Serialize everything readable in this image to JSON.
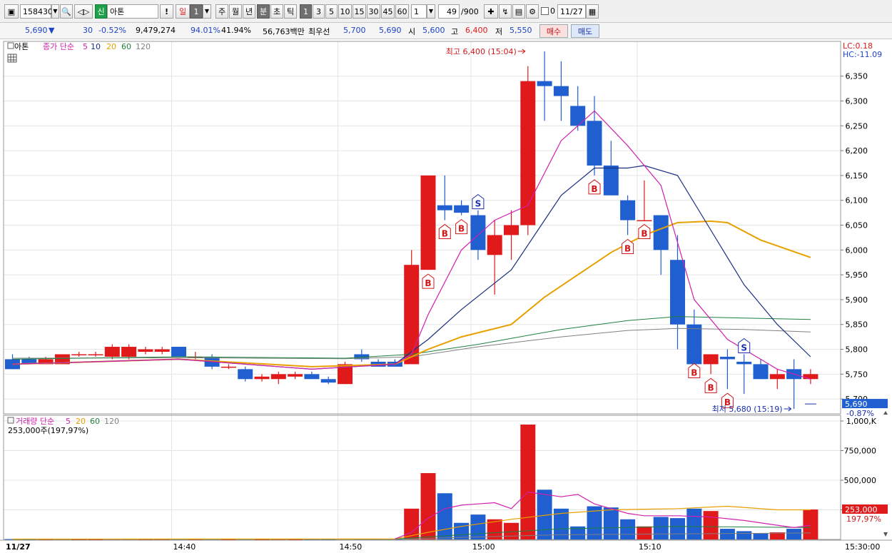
{
  "toolbar": {
    "code": "158430",
    "credit_tag": "신",
    "name": "아톤",
    "alert": "!",
    "day_label": "일",
    "day_count": "1",
    "periods": [
      "주",
      "월",
      "년",
      "분",
      "초",
      "틱"
    ],
    "selected_period": "분",
    "intervals": [
      "1",
      "3",
      "5",
      "10",
      "15",
      "30",
      "45",
      "60"
    ],
    "selected_interval": "1",
    "custom_interval": "1",
    "bar_count": "49",
    "bar_total": "/900",
    "checkbox_label": "0",
    "date": "11/27"
  },
  "quote": {
    "price": "5,690",
    "direction": "▼",
    "change": "30",
    "change_pct": "-0.52%",
    "volume": "9,479,274",
    "ratio1": "94.01%",
    "ratio2": "41.94%",
    "amount": "56,763백만",
    "best_ask_label": "최우선",
    "best_ask": "5,700",
    "best_bid": "5,690",
    "open_label": "시",
    "open": "5,600",
    "high_label": "고",
    "high": "6,400",
    "low_label": "저",
    "low": "5,550",
    "buy_label": "매수",
    "sell_label": "매도"
  },
  "colors": {
    "up": "#e0191b",
    "down": "#1f5fcf",
    "ma5": "#d020b0",
    "ma10": "#1a2f80",
    "ma20": "#e8a000",
    "ma60": "#208040",
    "ma120": "#808080"
  },
  "chart_data": {
    "type": "candlestick",
    "price_panel": {
      "name_tag": "아톤",
      "legend_label": "종가 단순",
      "ma_periods": [
        "5",
        "10",
        "20",
        "60",
        "120"
      ],
      "lc_text": "LC:0.18",
      "hc_text": "HC:-11.09",
      "y_ticks": [
        "6,350",
        "6,300",
        "6,250",
        "6,200",
        "6,150",
        "6,100",
        "6,050",
        "6,000",
        "5,950",
        "5,900",
        "5,850",
        "5,800",
        "5,750",
        "5,700"
      ],
      "ylim": [
        5670,
        6420
      ],
      "current_price": "5,690",
      "current_pct": "-0.87%",
      "high_note": "최고 6,400 (15:04)",
      "low_note": "최저 5,680 (15:19)"
    },
    "volume_panel": {
      "legend_label": "거래량 단순",
      "ma_periods": [
        "5",
        "20",
        "60",
        "120"
      ],
      "current_text": "253,000주(197,97%)",
      "y_ticks": [
        "1,000,K",
        "750,000",
        "500,000",
        "250,000"
      ],
      "ylim": [
        0,
        1000000
      ],
      "current_value": "253,000",
      "current_pct": "197,97%"
    },
    "x_labels": [
      {
        "text": "11/27",
        "i": 0
      },
      {
        "text": "14:40",
        "i": 10
      },
      {
        "text": "14:50",
        "i": 20
      },
      {
        "text": "15:00",
        "i": 28
      },
      {
        "text": "15:10",
        "i": 38
      },
      {
        "text": "15:30:00",
        "i": 48
      }
    ],
    "candles": [
      {
        "t": "14:30",
        "o": 5780,
        "h": 5790,
        "l": 5760,
        "c": 5760,
        "v": 3000
      },
      {
        "t": "14:31",
        "o": 5780,
        "h": 5785,
        "l": 5770,
        "c": 5770,
        "v": 2000
      },
      {
        "t": "14:32",
        "o": 5770,
        "h": 5785,
        "l": 5770,
        "c": 5780,
        "v": 2000
      },
      {
        "t": "14:33",
        "o": 5770,
        "h": 5790,
        "l": 5770,
        "c": 5790,
        "v": 3000
      },
      {
        "t": "14:34",
        "o": 5790,
        "h": 5795,
        "l": 5785,
        "c": 5790,
        "v": 1000
      },
      {
        "t": "14:35",
        "o": 5790,
        "h": 5795,
        "l": 5785,
        "c": 5790,
        "v": 1000
      },
      {
        "t": "14:36",
        "o": 5785,
        "h": 5810,
        "l": 5780,
        "c": 5805,
        "v": 4000
      },
      {
        "t": "14:37",
        "o": 5785,
        "h": 5810,
        "l": 5780,
        "c": 5805,
        "v": 4000
      },
      {
        "t": "14:38",
        "o": 5795,
        "h": 5805,
        "l": 5790,
        "c": 5800,
        "v": 2000
      },
      {
        "t": "14:39",
        "o": 5795,
        "h": 5805,
        "l": 5790,
        "c": 5800,
        "v": 2000
      },
      {
        "t": "14:40",
        "o": 5805,
        "h": 5805,
        "l": 5785,
        "c": 5785,
        "v": 3000
      },
      {
        "t": "14:41",
        "o": 5785,
        "h": 5795,
        "l": 5780,
        "c": 5785,
        "v": 2000
      },
      {
        "t": "14:42",
        "o": 5785,
        "h": 5790,
        "l": 5760,
        "c": 5765,
        "v": 3000
      },
      {
        "t": "14:43",
        "o": 5765,
        "h": 5770,
        "l": 5760,
        "c": 5765,
        "v": 1000
      },
      {
        "t": "14:44",
        "o": 5760,
        "h": 5765,
        "l": 5735,
        "c": 5740,
        "v": 3000
      },
      {
        "t": "14:45",
        "o": 5740,
        "h": 5750,
        "l": 5735,
        "c": 5745,
        "v": 1000
      },
      {
        "t": "14:46",
        "o": 5740,
        "h": 5755,
        "l": 5730,
        "c": 5750,
        "v": 2000
      },
      {
        "t": "14:47",
        "o": 5745,
        "h": 5755,
        "l": 5740,
        "c": 5750,
        "v": 1000
      },
      {
        "t": "14:48",
        "o": 5750,
        "h": 5755,
        "l": 5740,
        "c": 5740,
        "v": 2000
      },
      {
        "t": "14:49",
        "o": 5740,
        "h": 5745,
        "l": 5730,
        "c": 5733,
        "v": 2000
      },
      {
        "t": "14:50",
        "o": 5730,
        "h": 5775,
        "l": 5730,
        "c": 5770,
        "v": 6000
      },
      {
        "t": "14:51",
        "o": 5790,
        "h": 5800,
        "l": 5775,
        "c": 5780,
        "v": 5000
      },
      {
        "t": "14:52",
        "o": 5775,
        "h": 5780,
        "l": 5765,
        "c": 5765,
        "v": 4000
      },
      {
        "t": "14:53",
        "o": 5775,
        "h": 5780,
        "l": 5765,
        "c": 5765,
        "v": 4000
      },
      {
        "t": "14:54",
        "o": 5770,
        "h": 6000,
        "l": 5770,
        "c": 5970,
        "v": 260000
      },
      {
        "t": "14:55",
        "o": 5960,
        "h": 6150,
        "l": 5960,
        "c": 6150,
        "v": 560000
      },
      {
        "t": "14:56",
        "o": 6090,
        "h": 6150,
        "l": 6060,
        "c": 6080,
        "v": 390000
      },
      {
        "t": "14:57",
        "o": 6090,
        "h": 6100,
        "l": 6070,
        "c": 6075,
        "v": 140000
      },
      {
        "t": "14:58",
        "o": 6070,
        "h": 6080,
        "l": 5980,
        "c": 6000,
        "v": 210000
      },
      {
        "t": "14:59",
        "o": 5990,
        "h": 6060,
        "l": 5910,
        "c": 6030,
        "v": 170000
      },
      {
        "t": "15:00",
        "o": 6030,
        "h": 6080,
        "l": 5980,
        "c": 6050,
        "v": 140000
      },
      {
        "t": "15:01",
        "o": 6050,
        "h": 6370,
        "l": 6030,
        "c": 6340,
        "v": 970000
      },
      {
        "t": "15:02",
        "o": 6340,
        "h": 6400,
        "l": 6260,
        "c": 6330,
        "v": 420000
      },
      {
        "t": "15:03",
        "o": 6330,
        "h": 6380,
        "l": 6260,
        "c": 6310,
        "v": 260000
      },
      {
        "t": "15:04",
        "o": 6290,
        "h": 6330,
        "l": 6240,
        "c": 6250,
        "v": 110000
      },
      {
        "t": "15:05",
        "o": 6260,
        "h": 6310,
        "l": 6150,
        "c": 6170,
        "v": 280000
      },
      {
        "t": "15:06",
        "o": 6170,
        "h": 6220,
        "l": 6110,
        "c": 6110,
        "v": 270000
      },
      {
        "t": "15:07",
        "o": 6100,
        "h": 6110,
        "l": 6030,
        "c": 6060,
        "v": 170000
      },
      {
        "t": "15:08",
        "o": 6060,
        "h": 6140,
        "l": 6060,
        "c": 6060,
        "v": 110000
      },
      {
        "t": "15:09",
        "o": 6070,
        "h": 6070,
        "l": 5950,
        "c": 6000,
        "v": 190000
      },
      {
        "t": "15:10",
        "o": 5980,
        "h": 6030,
        "l": 5800,
        "c": 5850,
        "v": 180000
      },
      {
        "t": "15:11",
        "o": 5850,
        "h": 5880,
        "l": 5780,
        "c": 5770,
        "v": 260000
      },
      {
        "t": "15:12",
        "o": 5770,
        "h": 5790,
        "l": 5750,
        "c": 5790,
        "v": 240000
      },
      {
        "t": "15:13",
        "o": 5785,
        "h": 5800,
        "l": 5720,
        "c": 5780,
        "v": 90000
      },
      {
        "t": "15:14",
        "o": 5775,
        "h": 5790,
        "l": 5710,
        "c": 5770,
        "v": 70000
      },
      {
        "t": "15:15",
        "o": 5770,
        "h": 5780,
        "l": 5740,
        "c": 5740,
        "v": 50000
      },
      {
        "t": "15:16",
        "o": 5740,
        "h": 5760,
        "l": 5720,
        "c": 5750,
        "v": 60000
      },
      {
        "t": "15:17",
        "o": 5760,
        "h": 5780,
        "l": 5680,
        "c": 5740,
        "v": 90000
      },
      {
        "t": "15:18",
        "o": 5740,
        "h": 5760,
        "l": 5730,
        "c": 5750,
        "v": 253000
      }
    ],
    "ma_lines": {
      "ma5": [
        [
          0,
          5770
        ],
        [
          10,
          5780
        ],
        [
          18,
          5760
        ],
        [
          23,
          5770
        ],
        [
          24,
          5790
        ],
        [
          25,
          5870
        ],
        [
          27,
          6000
        ],
        [
          29,
          6060
        ],
        [
          31,
          6090
        ],
        [
          33,
          6220
        ],
        [
          35,
          6280
        ],
        [
          37,
          6210
        ],
        [
          39,
          6130
        ],
        [
          41,
          5900
        ],
        [
          43,
          5820
        ],
        [
          46,
          5760
        ],
        [
          48,
          5740
        ]
      ],
      "ma10": [
        [
          0,
          5770
        ],
        [
          10,
          5780
        ],
        [
          18,
          5760
        ],
        [
          23,
          5770
        ],
        [
          25,
          5820
        ],
        [
          27,
          5880
        ],
        [
          30,
          5960
        ],
        [
          33,
          6110
        ],
        [
          35,
          6165
        ],
        [
          37,
          6165
        ],
        [
          38,
          6170
        ],
        [
          40,
          6150
        ],
        [
          42,
          6040
        ],
        [
          44,
          5930
        ],
        [
          46,
          5850
        ],
        [
          48,
          5785
        ]
      ],
      "ma20": [
        [
          0,
          5770
        ],
        [
          10,
          5780
        ],
        [
          18,
          5765
        ],
        [
          23,
          5770
        ],
        [
          25,
          5800
        ],
        [
          27,
          5825
        ],
        [
          30,
          5850
        ],
        [
          32,
          5905
        ],
        [
          34,
          5950
        ],
        [
          36,
          5995
        ],
        [
          38,
          6030
        ],
        [
          40,
          6055
        ],
        [
          42,
          6058
        ],
        [
          43,
          6055
        ],
        [
          45,
          6020
        ],
        [
          48,
          5985
        ]
      ],
      "ma60": [
        [
          0,
          5780
        ],
        [
          10,
          5785
        ],
        [
          20,
          5782
        ],
        [
          24,
          5790
        ],
        [
          28,
          5810
        ],
        [
          33,
          5840
        ],
        [
          37,
          5858
        ],
        [
          40,
          5866
        ],
        [
          44,
          5863
        ],
        [
          48,
          5860
        ]
      ],
      "ma120": [
        [
          0,
          5782
        ],
        [
          10,
          5783
        ],
        [
          20,
          5781
        ],
        [
          24,
          5785
        ],
        [
          28,
          5805
        ],
        [
          33,
          5825
        ],
        [
          37,
          5838
        ],
        [
          40,
          5842
        ],
        [
          44,
          5840
        ],
        [
          48,
          5835
        ]
      ]
    },
    "vol_ma": {
      "ma5": [
        [
          23,
          4000
        ],
        [
          24,
          60000
        ],
        [
          25,
          180000
        ],
        [
          26,
          260000
        ],
        [
          27,
          290000
        ],
        [
          28,
          300000
        ],
        [
          29,
          310000
        ],
        [
          30,
          260000
        ],
        [
          31,
          400000
        ],
        [
          32,
          380000
        ],
        [
          33,
          360000
        ],
        [
          34,
          380000
        ],
        [
          35,
          300000
        ],
        [
          36,
          260000
        ],
        [
          37,
          220000
        ],
        [
          38,
          200000
        ],
        [
          40,
          200000
        ],
        [
          42,
          190000
        ],
        [
          44,
          160000
        ],
        [
          46,
          120000
        ],
        [
          47,
          100000
        ],
        [
          48,
          120000
        ]
      ],
      "ma20": [
        [
          0,
          3000
        ],
        [
          23,
          4000
        ],
        [
          25,
          60000
        ],
        [
          27,
          110000
        ],
        [
          30,
          170000
        ],
        [
          33,
          220000
        ],
        [
          36,
          250000
        ],
        [
          40,
          260000
        ],
        [
          43,
          280000
        ],
        [
          46,
          250000
        ],
        [
          48,
          250000
        ]
      ],
      "ma60": [
        [
          0,
          2000
        ],
        [
          23,
          3000
        ],
        [
          27,
          40000
        ],
        [
          33,
          90000
        ],
        [
          40,
          110000
        ],
        [
          48,
          100000
        ]
      ],
      "ma120": [
        [
          0,
          1500
        ],
        [
          23,
          2000
        ],
        [
          33,
          40000
        ],
        [
          48,
          55000
        ]
      ]
    },
    "signals": [
      {
        "i": 25,
        "type": "B"
      },
      {
        "i": 26,
        "type": "B"
      },
      {
        "i": 27,
        "type": "B"
      },
      {
        "i": 28,
        "type": "S"
      },
      {
        "i": 35,
        "type": "B"
      },
      {
        "i": 37,
        "type": "B"
      },
      {
        "i": 38,
        "type": "B"
      },
      {
        "i": 41,
        "type": "B"
      },
      {
        "i": 42,
        "type": "B"
      },
      {
        "i": 43,
        "type": "B"
      },
      {
        "i": 44,
        "type": "S"
      }
    ]
  }
}
